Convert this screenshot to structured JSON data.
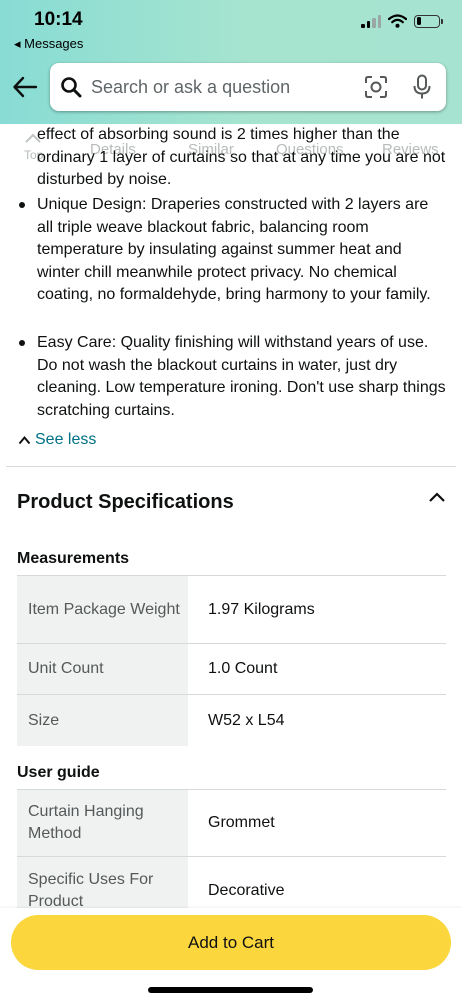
{
  "status_bar": {
    "time": "10:14",
    "back_label": "◂ Messages",
    "signal_bars": 4,
    "signal_active": 2,
    "battery_level": 0.2
  },
  "search": {
    "placeholder": "Search or ask a question"
  },
  "nav_tabs": [
    "Top",
    "Details",
    "Similar",
    "Questions",
    "Reviews"
  ],
  "description": {
    "partial_line": "effect of absorbing sound is 2 times higher than the ordinary 1 layer of curtains so that at any time you are not disturbed by noise.",
    "bullets": [
      "Unique Design: Draperies constructed with 2 layers are all triple weave blackout fabric, balancing room temperature by insulating against summer heat and winter chill meanwhile protect privacy. No chemical coating, no formaldehyde, bring harmony to your family.",
      "Easy Care: Quality finishing will withstand years of use. Do not wash the blackout curtains in water, just dry cleaning. Low temperature ironing. Don't use sharp things scratching curtains."
    ],
    "see_less": "See less"
  },
  "specifications": {
    "title": "Product Specifications",
    "groups": [
      {
        "title": "Measurements",
        "rows": [
          {
            "key": "Item Package Weight",
            "value": "1.97 Kilograms"
          },
          {
            "key": "Unit Count",
            "value": "1.0 Count"
          },
          {
            "key": "Size",
            "value": "W52 x L54"
          }
        ]
      },
      {
        "title": "User guide",
        "rows": [
          {
            "key": "Curtain Hanging Method",
            "value": "Grommet"
          },
          {
            "key": "Specific Uses For Product",
            "value": "Decorative"
          }
        ]
      }
    ]
  },
  "cart": {
    "add_to_cart": "Add to Cart",
    "button_color": "#fcd63d"
  },
  "colors": {
    "header_gradient_start": "#88dcd4",
    "header_gradient_end": "#a6e3d0",
    "link": "#007185",
    "spec_key_bg": "#f0f2f2"
  }
}
